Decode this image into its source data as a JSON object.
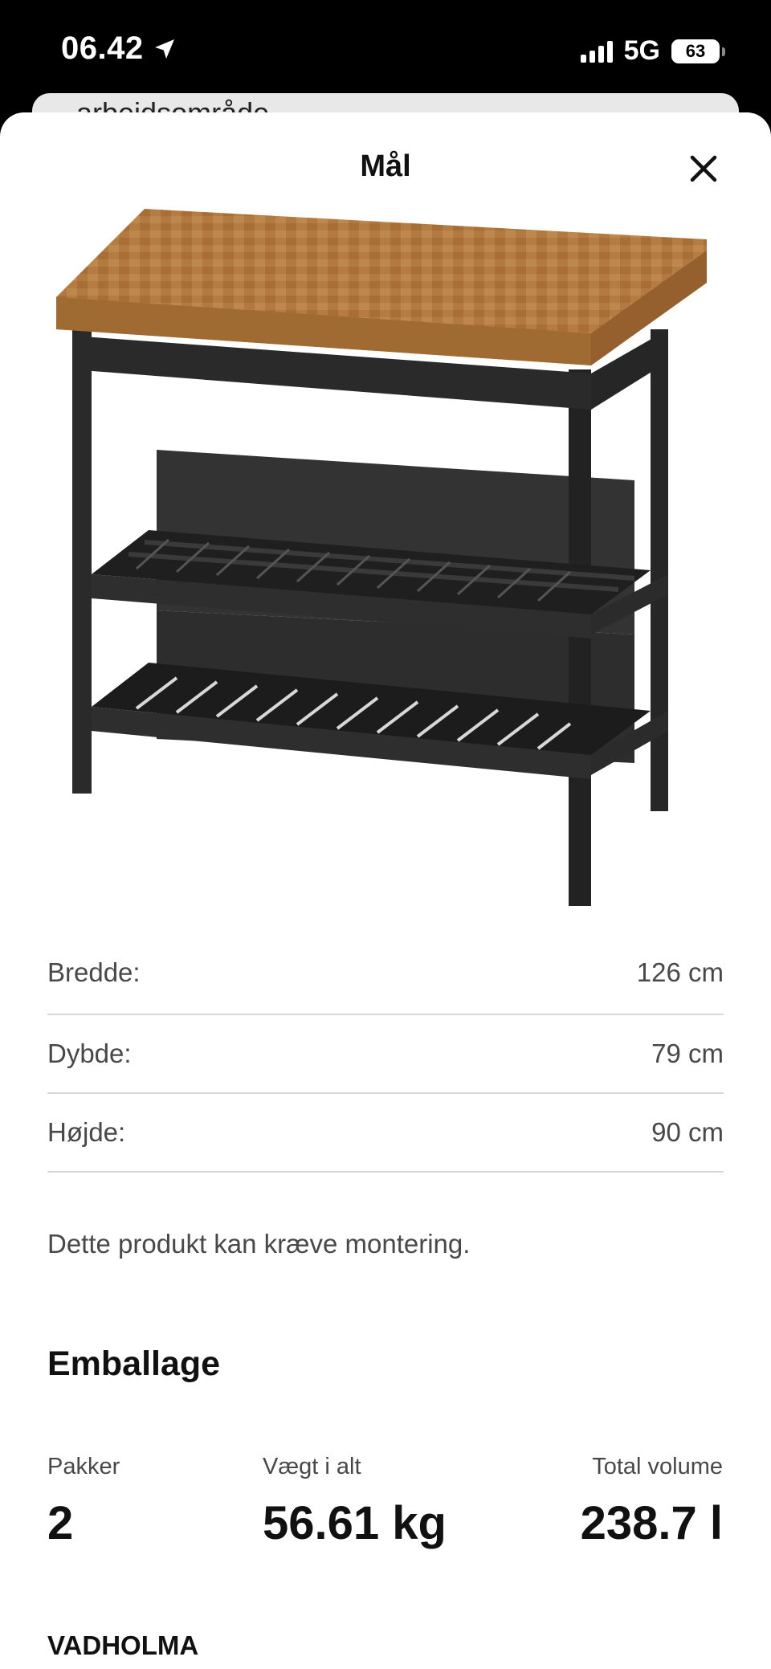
{
  "status_bar": {
    "time": "06.42",
    "network": "5G",
    "battery": "63"
  },
  "background_sheet": {
    "partial_text": "arbeidsområde"
  },
  "sheet": {
    "title": "Mål",
    "close_icon": "close-icon"
  },
  "product_image": {
    "description_icon": "kitchen-island-image"
  },
  "dimensions": [
    {
      "label": "Bredde:",
      "value": "126 cm"
    },
    {
      "label": "Dybde:",
      "value": "79 cm"
    },
    {
      "label": "Højde:",
      "value": "90 cm"
    }
  ],
  "assembly_note": "Dette produkt kan kræve montering.",
  "packaging": {
    "heading": "Emballage",
    "packages_label": "Pakker",
    "packages_value": "2",
    "weight_label": "Vægt i alt",
    "weight_value": "56.61 kg",
    "volume_label": "Total volume",
    "volume_value": "238.7 l"
  },
  "product_name": "VADHOLMA",
  "colors": {
    "wood": "#B0773D",
    "frame": "#2B2B2B",
    "divider": "#D8D8D8"
  }
}
